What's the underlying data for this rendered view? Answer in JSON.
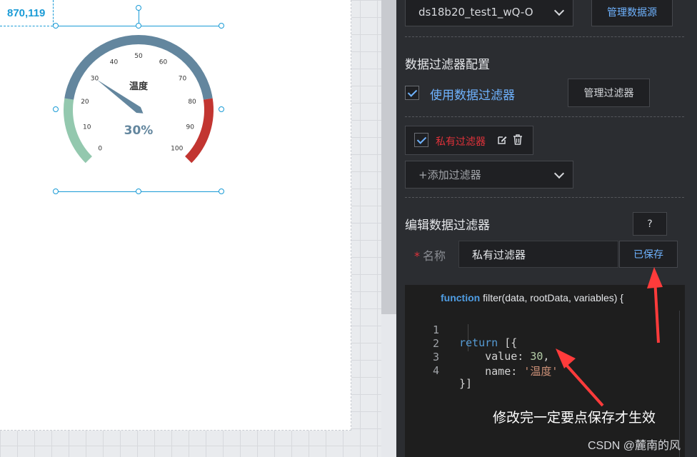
{
  "canvas": {
    "coord_label": "870,119"
  },
  "gauge": {
    "title": "温度",
    "value_text": "30%",
    "value": 30,
    "min": 0,
    "max": 100,
    "ticks": [
      "0",
      "10",
      "20",
      "30",
      "40",
      "50",
      "60",
      "70",
      "80",
      "90",
      "100"
    ],
    "colors": {
      "low": "#93c8ae",
      "mid": "#63869e",
      "high": "#c23531",
      "pointer": "#63869e"
    }
  },
  "panel": {
    "datasource_select": "ds18b20_test1_wQ-O",
    "manage_datasource_button": "管理数据源",
    "filter_config_title": "数据过滤器配置",
    "use_filter_label": "使用数据过滤器",
    "manage_filter_button": "管理过滤器",
    "private_filter_name": "私有过滤器",
    "add_filter_placeholder": "+添加过滤器",
    "edit_filter_title": "编辑数据过滤器",
    "help_button": "?",
    "name_label": "名称",
    "name_required_mark": "*",
    "name_value": "私有过滤器",
    "saved_button": "已保存",
    "function_keyword": "function",
    "function_signature": "filter(data, rootData, variables) {"
  },
  "code": {
    "lines": [
      {
        "num": "1",
        "text": "return [{"
      },
      {
        "num": "2",
        "text": "    value: 30,"
      },
      {
        "num": "3",
        "text": "    name: '温度'"
      },
      {
        "num": "4",
        "text": "}]"
      }
    ]
  },
  "annotation": {
    "text": "修改完一定要点保存才生效"
  },
  "watermark": "CSDN @麓南的风",
  "colors": {
    "accent": "#1a9bd6",
    "link": "#6fb3ff",
    "danger": "#e0323a",
    "arrow": "#ff3b3b"
  }
}
